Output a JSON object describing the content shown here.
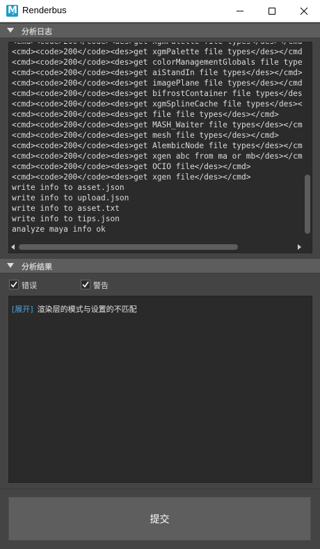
{
  "window": {
    "title": "Renderbus",
    "logo_letter": "M",
    "logo_sub": "2"
  },
  "analysis_log": {
    "header": "分析日志",
    "lines": [
      "<cmd><code>200</code><des>get xgmPalette file types</des></cmd>",
      "<cmd><code>200</code><des>get xgmPalette file types</des></cmd>",
      "<cmd><code>200</code><des>get colorManagementGlobals file types</des></cmd>",
      "<cmd><code>200</code><des>get aiStandIn file types</des></cmd>",
      "<cmd><code>200</code><des>get imagePlane file types</des></cmd>",
      "<cmd><code>200</code><des>get bifrostContainer file types</des></cmd>",
      "<cmd><code>200</code><des>get xgmSplineCache file types</des></cmd>",
      "<cmd><code>200</code><des>get file file types</des></cmd>",
      "<cmd><code>200</code><des>get MASH_Waiter file types</des></cmd>",
      "<cmd><code>200</code><des>get mesh file types</des></cmd>",
      "<cmd><code>200</code><des>get AlembicNode file types</des></cmd>",
      "<cmd><code>200</code><des>get xgen abc from ma or mb</des></cmd>",
      "<cmd><code>200</code><des>get OCIO file</des></cmd>",
      "<cmd><code>200</code><des>get xgen file</des></cmd>",
      "write info to asset.json",
      "write info to upload.json",
      "write info to asset.txt",
      "write info to tips.json",
      "analyze maya info ok"
    ]
  },
  "analysis_result": {
    "header": "分析结果",
    "filters": [
      {
        "label": "错误",
        "checked": true
      },
      {
        "label": "警告",
        "checked": true
      }
    ],
    "items": [
      {
        "expand_label": "[展开]",
        "message": "渲染层的模式与设置的不匹配"
      }
    ]
  },
  "footer": {
    "submit_label": "提交"
  },
  "colors": {
    "window_bg": "#444444",
    "panel_bg": "#2b2b2b",
    "header_bg": "#5d5d5d",
    "link": "#4aa3df",
    "maya_logo": "#1c9cc8"
  }
}
